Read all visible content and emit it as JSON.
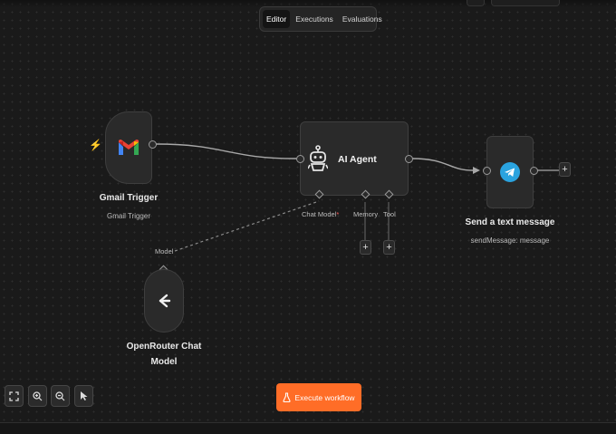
{
  "tabs": {
    "editor": "Editor",
    "executions": "Executions",
    "evaluations": "Evaluations"
  },
  "nodes": {
    "gmail": {
      "title": "Gmail Trigger",
      "subtitle": "Gmail Trigger",
      "icon": "gmail-icon"
    },
    "agent": {
      "title": "AI Agent",
      "icon": "robot-icon",
      "ports": {
        "chat_model": "Chat Model",
        "chat_model_required": "*",
        "memory": "Memory",
        "tool": "Tool"
      }
    },
    "telegram": {
      "title": "Send a text message",
      "subtitle": "sendMessage: message",
      "icon": "telegram-icon"
    },
    "openrouter": {
      "title_line1": "OpenRouter Chat",
      "title_line2": "Model",
      "port": "Model",
      "icon": "openrouter-icon"
    }
  },
  "controls": {
    "icons": [
      "fit-view-icon",
      "zoom-in-icon",
      "zoom-out-icon",
      "cursor-icon"
    ]
  },
  "execute": {
    "label": "Execute workflow",
    "icon": "flask-icon"
  },
  "colors": {
    "accent": "#ff6d27",
    "trigger_bolt": "#ff7a2f",
    "telegram": "#2aa3df",
    "required": "#ff5a5a"
  }
}
